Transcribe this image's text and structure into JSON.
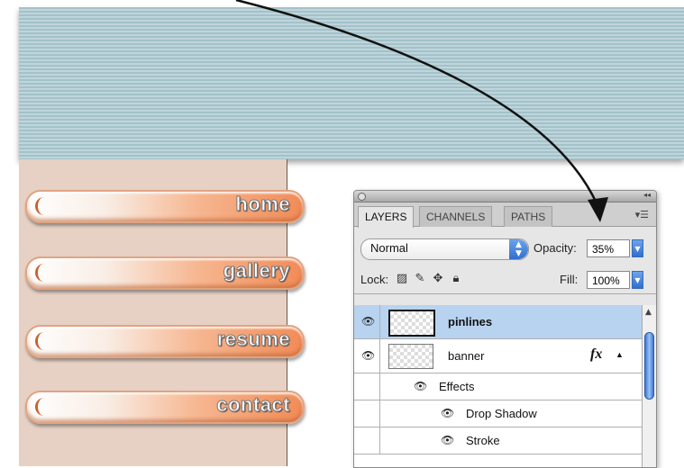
{
  "nav": {
    "items": [
      {
        "label": "home"
      },
      {
        "label": "gallery"
      },
      {
        "label": "resume"
      },
      {
        "label": "contact"
      }
    ]
  },
  "panel": {
    "tabs": [
      {
        "label": "LAYERS"
      },
      {
        "label": "CHANNELS"
      },
      {
        "label": "PATHS"
      }
    ],
    "blend_mode": "Normal",
    "opacity_label": "Opacity:",
    "opacity_value": "35%",
    "lock_label": "Lock:",
    "fill_label": "Fill:",
    "fill_value": "100%",
    "layers": [
      {
        "name": "pinlines",
        "selected": true
      },
      {
        "name": "banner",
        "fx": "fx"
      }
    ],
    "effects": {
      "label": "Effects",
      "items": [
        {
          "name": "Drop Shadow"
        },
        {
          "name": "Stroke"
        }
      ]
    }
  },
  "colors": {
    "banner_stripe_dark": "#a3c2ca",
    "banner_stripe_light": "#bfd5db",
    "sidebar": "#e6d1c4",
    "button_orange": "#f18b57",
    "selected_layer": "#b8d3ef"
  }
}
